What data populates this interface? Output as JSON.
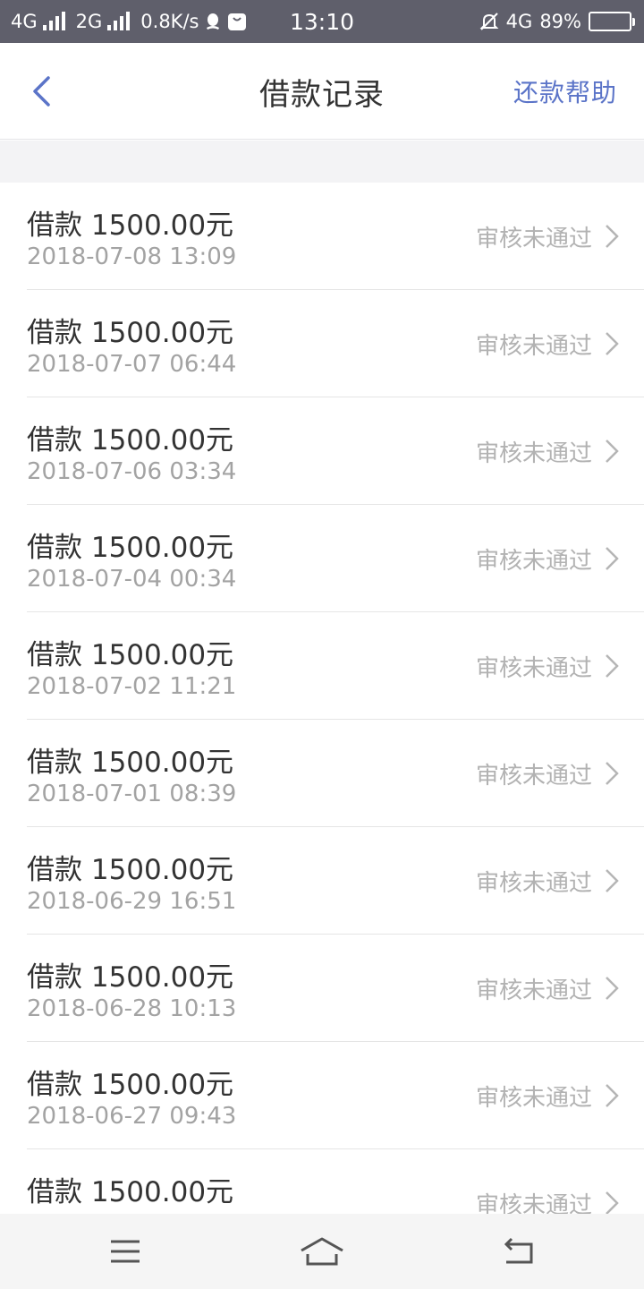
{
  "status_bar": {
    "network_1": "4G",
    "network_2": "2G",
    "speed": "0.8K/s",
    "time": "13:10",
    "network_3": "4G",
    "battery": "89%",
    "battery_level": 0.89
  },
  "nav": {
    "title": "借款记录",
    "action": "还款帮助"
  },
  "records": [
    {
      "title": "借款 1500.00元",
      "date": "2018-07-08 13:09",
      "status": "审核未通过"
    },
    {
      "title": "借款 1500.00元",
      "date": "2018-07-07 06:44",
      "status": "审核未通过"
    },
    {
      "title": "借款 1500.00元",
      "date": "2018-07-06 03:34",
      "status": "审核未通过"
    },
    {
      "title": "借款 1500.00元",
      "date": "2018-07-04 00:34",
      "status": "审核未通过"
    },
    {
      "title": "借款 1500.00元",
      "date": "2018-07-02 11:21",
      "status": "审核未通过"
    },
    {
      "title": "借款 1500.00元",
      "date": "2018-07-01 08:39",
      "status": "审核未通过"
    },
    {
      "title": "借款 1500.00元",
      "date": "2018-06-29 16:51",
      "status": "审核未通过"
    },
    {
      "title": "借款 1500.00元",
      "date": "2018-06-28 10:13",
      "status": "审核未通过"
    },
    {
      "title": "借款 1500.00元",
      "date": "2018-06-27 09:43",
      "status": "审核未通过"
    },
    {
      "title": "借款 1500.00元",
      "date": "",
      "status": "审核未通过"
    }
  ],
  "colors": {
    "accent": "#5b74c8",
    "status_bar": "#5f5f6b",
    "text_primary": "#333333",
    "text_secondary": "#a3a3a3"
  },
  "icons": {
    "back": "chevron-left-icon",
    "row": "chevron-right-icon",
    "sys_menu": "menu-icon",
    "sys_home": "home-icon",
    "sys_back": "return-icon"
  }
}
